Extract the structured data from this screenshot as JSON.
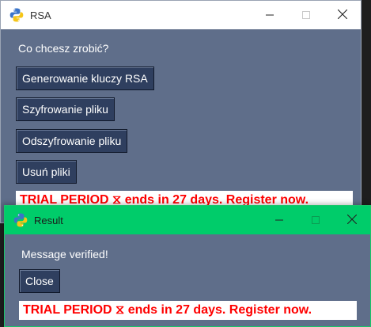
{
  "main_window": {
    "title": "RSA",
    "prompt": "Co chcesz zrobić?",
    "buttons": {
      "generate": "Generowanie kluczy RSA",
      "encrypt": "Szyfrowanie pliku",
      "decrypt": "Odszyfrowanie pliku",
      "delete": "Usuń pliki"
    },
    "trial_banner": "TRIAL PERIOD ⧖ ends in 27 days. Register now."
  },
  "result_window": {
    "title": "Result",
    "message": "Message verified!",
    "close_label": "Close",
    "trial_banner": "TRIAL PERIOD ⧖ ends in 27 days. Register now."
  },
  "colors": {
    "window_bg": "#5f6e8a",
    "button_bg": "#2f3f5f",
    "result_titlebar": "#00cc6a",
    "trial_text": "#ff0000"
  },
  "icons": {
    "app": "python-icon",
    "minimize": "minimize-icon",
    "maximize": "maximize-icon",
    "close": "close-icon"
  }
}
